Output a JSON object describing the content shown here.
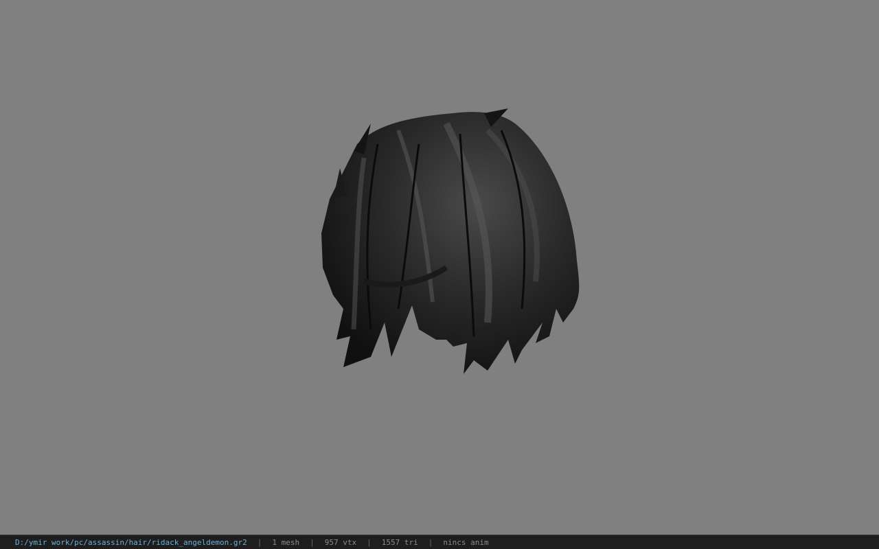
{
  "viewport": {
    "background_color": "#808080",
    "model_icon": "hair-mesh"
  },
  "statusbar": {
    "file_path": "D:/ymir work/pc/assassin/hair/ridack_angeldemon.gr2",
    "separator": "|",
    "mesh_count": "1 mesh",
    "vertex_count": "957 vtx",
    "triangle_count": "1557 tri",
    "anim_status": "nincs anim",
    "path_color": "#6fb0d8",
    "text_color": "#8c8c8c"
  }
}
